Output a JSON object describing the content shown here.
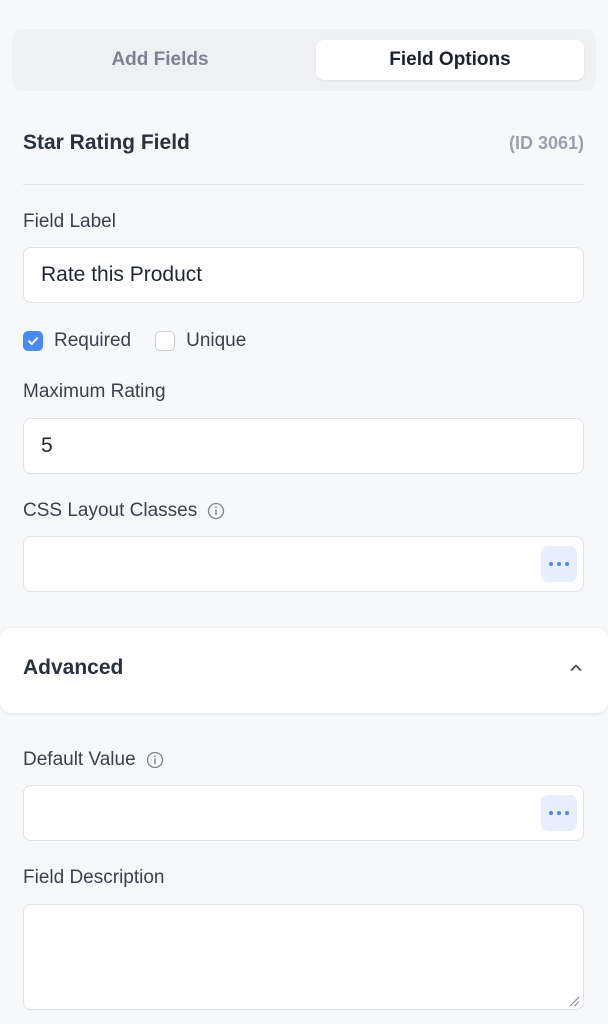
{
  "tabs": {
    "add_fields": "Add Fields",
    "field_options": "Field Options"
  },
  "field": {
    "title": "Star Rating Field",
    "id_text": "(ID 3061)"
  },
  "field_label": {
    "label": "Field Label",
    "value": "Rate this Product"
  },
  "options": {
    "required": {
      "label": "Required",
      "checked": true
    },
    "unique": {
      "label": "Unique",
      "checked": false
    }
  },
  "max_rating": {
    "label": "Maximum Rating",
    "value": "5"
  },
  "css_classes": {
    "label": "CSS Layout Classes",
    "value": ""
  },
  "advanced": {
    "title": "Advanced",
    "expanded": true
  },
  "default_value": {
    "label": "Default Value",
    "value": ""
  },
  "description": {
    "label": "Field Description",
    "value": ""
  },
  "colors": {
    "accent": "#4a8af0",
    "more_button_bg": "#e7efff"
  },
  "icons": {
    "checkbox_checked": "check-icon",
    "info": "info-icon",
    "more": "ellipsis-icon",
    "collapse": "chevron-up-icon",
    "resize": "resize-handle-icon"
  }
}
